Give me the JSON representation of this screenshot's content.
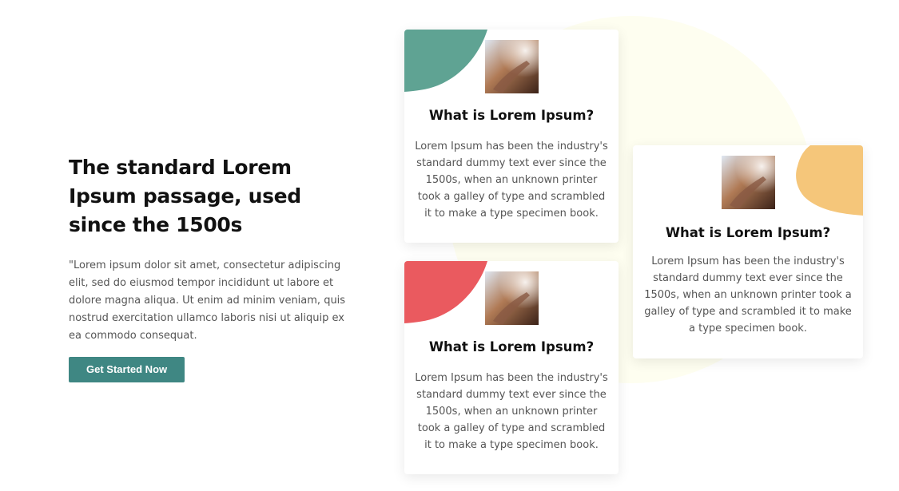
{
  "hero": {
    "title": "The standard Lorem Ipsum passage, used since the 1500s",
    "body": "\"Lorem ipsum dolor sit amet, consectetur adipiscing elit, sed do eiusmod tempor incididunt ut labore et dolore magna aliqua. Ut enim ad minim veniam, quis nostrud exercitation ullamco laboris nisi ut aliquip ex ea commodo consequat.",
    "cta_label": "Get Started Now"
  },
  "cards": [
    {
      "title": "What is Lorem Ipsum?",
      "text": "Lorem Ipsum has been the industry's standard dummy text ever since the 1500s, when an unknown printer took a galley of type and scrambled it to make a type specimen book.",
      "accent": "#5fa393"
    },
    {
      "title": "What is Lorem Ipsum?",
      "text": "Lorem Ipsum has been the industry's standard dummy text ever since the 1500s, when an unknown printer took a galley of type and scrambled it to make a type specimen book.",
      "accent": "#ea5a5f"
    },
    {
      "title": "What is Lorem Ipsum?",
      "text": "Lorem Ipsum has been the industry's standard dummy text ever since the 1500s, when an unknown printer took a galley of type and scrambled it to make a type specimen book.",
      "accent": "#f5c67a"
    }
  ],
  "colors": {
    "button": "#3f8783",
    "background_blob": "#fefef0"
  }
}
